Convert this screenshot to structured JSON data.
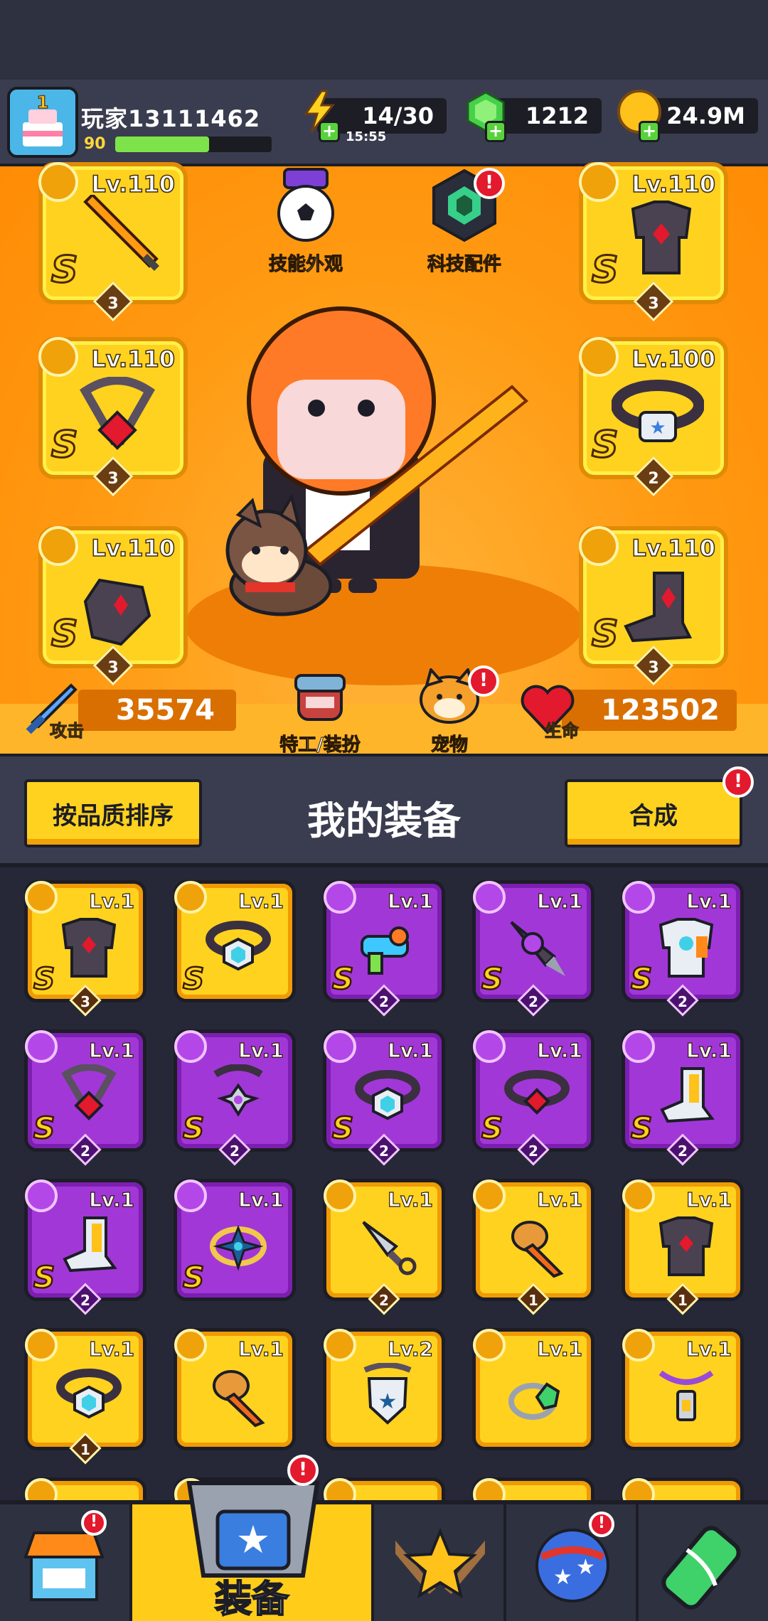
{
  "player": {
    "name": "玩家13111462",
    "level": "90",
    "xp_fraction": 0.6
  },
  "resources": {
    "energy": "14/30",
    "energy_timer": "15:55",
    "gems": "1212",
    "gold": "24.9M"
  },
  "stage": {
    "skin_label": "技能外观",
    "tech_label": "科技配件",
    "agent_label": "特工/装扮",
    "pet_label": "宠物",
    "attack_label": "攻击",
    "attack_value": "35574",
    "hp_label": "生命",
    "hp_value": "123502",
    "badge": "!"
  },
  "equipped": [
    {
      "level": "Lv.110",
      "rank": "S",
      "stars": "3",
      "icon": "sword-icon"
    },
    {
      "level": "Lv.110",
      "rank": "S",
      "stars": "3",
      "icon": "armor-icon"
    },
    {
      "level": "Lv.110",
      "rank": "S",
      "stars": "3",
      "icon": "necklace-icon"
    },
    {
      "level": "Lv.100",
      "rank": "S",
      "stars": "2",
      "icon": "belt-icon"
    },
    {
      "level": "Lv.110",
      "rank": "S",
      "stars": "3",
      "icon": "glove-icon"
    },
    {
      "level": "Lv.110",
      "rank": "S",
      "stars": "3",
      "icon": "boot-icon"
    }
  ],
  "inventory": {
    "sort_button": "按品质排序",
    "title": "我的装备",
    "merge_button": "合成",
    "items": [
      {
        "level": "Lv.1",
        "rank": "S",
        "stars": "3",
        "quality": "gold",
        "icon": "armor-icon"
      },
      {
        "level": "Lv.1",
        "rank": "S",
        "stars": "",
        "quality": "gold",
        "icon": "belt-icon"
      },
      {
        "level": "Lv.1",
        "rank": "S",
        "stars": "2",
        "quality": "purple",
        "icon": "blaster-icon"
      },
      {
        "level": "Lv.1",
        "rank": "S",
        "stars": "2",
        "quality": "purple",
        "icon": "drill-icon"
      },
      {
        "level": "Lv.1",
        "rank": "S",
        "stars": "2",
        "quality": "purple",
        "icon": "mech-armor-icon"
      },
      {
        "level": "Lv.1",
        "rank": "S",
        "stars": "2",
        "quality": "purple",
        "icon": "necklace-icon"
      },
      {
        "level": "Lv.1",
        "rank": "S",
        "stars": "2",
        "quality": "purple",
        "icon": "gem-necklace-icon"
      },
      {
        "level": "Lv.1",
        "rank": "S",
        "stars": "2",
        "quality": "purple",
        "icon": "belt-icon"
      },
      {
        "level": "Lv.1",
        "rank": "S",
        "stars": "2",
        "quality": "purple",
        "icon": "ruby-belt-icon"
      },
      {
        "level": "Lv.1",
        "rank": "S",
        "stars": "2",
        "quality": "purple",
        "icon": "boot-icon"
      },
      {
        "level": "Lv.1",
        "rank": "S",
        "stars": "2",
        "quality": "purple",
        "icon": "boot-icon"
      },
      {
        "level": "Lv.1",
        "rank": "S",
        "stars": "",
        "quality": "purple",
        "icon": "star-ring-icon"
      },
      {
        "level": "Lv.1",
        "rank": "",
        "stars": "2",
        "quality": "gold",
        "icon": "kunai-icon"
      },
      {
        "level": "Lv.1",
        "rank": "",
        "stars": "1",
        "quality": "gold",
        "icon": "torch-icon"
      },
      {
        "level": "Lv.1",
        "rank": "",
        "stars": "1",
        "quality": "gold",
        "icon": "armor-icon"
      },
      {
        "level": "Lv.1",
        "rank": "",
        "stars": "1",
        "quality": "gold",
        "icon": "belt-icon"
      },
      {
        "level": "Lv.1",
        "rank": "",
        "stars": "",
        "quality": "gold",
        "icon": "torch-icon"
      },
      {
        "level": "Lv.2",
        "rank": "",
        "stars": "",
        "quality": "gold",
        "icon": "shield-necklace-icon"
      },
      {
        "level": "Lv.1",
        "rank": "",
        "stars": "",
        "quality": "gold",
        "icon": "emerald-ring-icon"
      },
      {
        "level": "Lv.1",
        "rank": "",
        "stars": "",
        "quality": "gold",
        "icon": "lantern-necklace-icon"
      }
    ]
  },
  "nav": {
    "shop": "shop-icon",
    "equipment_label": "装备",
    "talent": "talent-icon",
    "missions": "planet-icon",
    "evolve": "dna-icon"
  },
  "colors": {
    "gold_item": "#ffd21f",
    "purple_item": "#a237d8",
    "stage_bg": "#ff9a12",
    "badge_red": "#e3192d"
  }
}
